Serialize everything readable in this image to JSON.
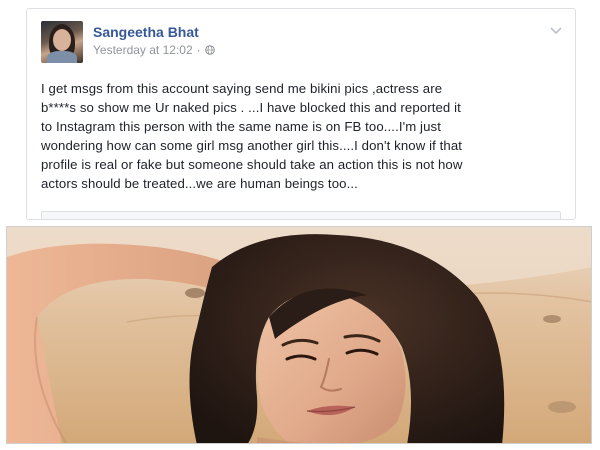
{
  "post": {
    "author_name": "Sangeetha Bhat",
    "timestamp": "Yesterday at 12:02",
    "meta_separator": "·",
    "privacy_icon": "globe-icon",
    "options_icon": "chevron-down-icon",
    "body_lines": [
      "I get msgs from this account saying send me bikini pics ,actress are",
      "b****s so show me Ur naked pics . ...I have blocked this and reported it",
      "to Instagram this person with the same name is on FB too....I'm just",
      "wondering how can some girl msg another girl this....I don't know if that",
      "profile is real or fake but someone should take an action this is not how",
      "actors should be treated...we are human beings too..."
    ]
  },
  "photo": {
    "subject": "woman-portrait-photo",
    "colors": {
      "sand": "#d9b48c",
      "sky": "#e9d6c2",
      "hair": "#2b1d17",
      "skin": "#e0a98a"
    }
  }
}
